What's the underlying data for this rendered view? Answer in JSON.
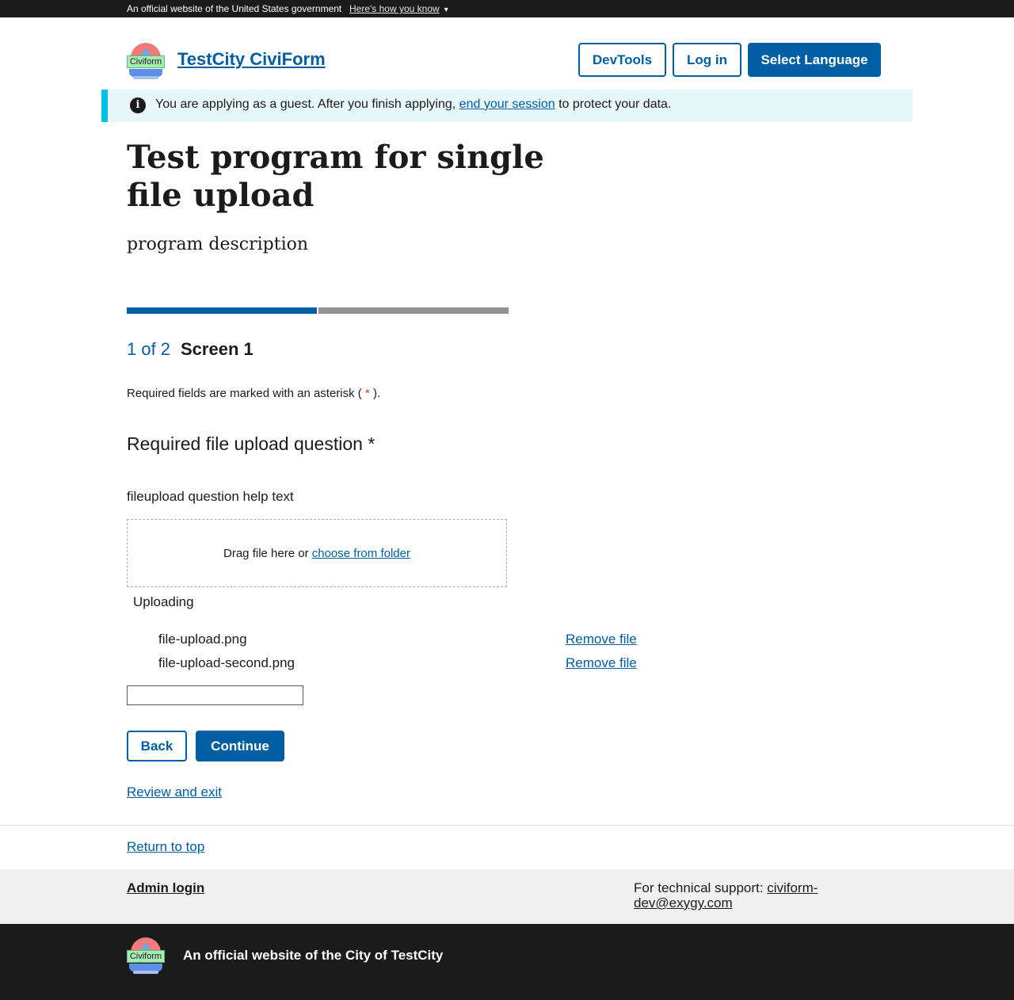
{
  "gov_banner": {
    "text": "An official website of the United States government",
    "link": "Here's how you know",
    "link_icon": "chevron-down-icon"
  },
  "header": {
    "logo_text": "Civiform",
    "site_title": "TestCity CiviForm",
    "devtools_label": "DevTools",
    "login_label": "Log in",
    "language_label": "Select Language"
  },
  "alert": {
    "icon": "info-icon",
    "text_before": "You are applying as a guest. After you finish applying, ",
    "link": "end your session",
    "text_after": " to protect your data."
  },
  "program": {
    "title": "Test program for single file upload",
    "description": "program description"
  },
  "progress": {
    "current_step": 1,
    "total_steps": 2,
    "step_label": "1 of 2",
    "screen_name": "Screen 1"
  },
  "form": {
    "required_note_before": "Required fields are marked with an asterisk (",
    "required_asterisk": "*",
    "required_note_after": ").",
    "question_title": "Required file upload question *",
    "question_help": "fileupload question help text",
    "dropzone_text": "Drag file here or ",
    "dropzone_link": "choose from folder",
    "uploading_label": "Uploading",
    "files": [
      {
        "name": "file-upload.png",
        "remove_label": "Remove file"
      },
      {
        "name": "file-upload-second.png",
        "remove_label": "Remove file"
      }
    ],
    "back_label": "Back",
    "continue_label": "Continue",
    "review_label": "Review and exit"
  },
  "footer": {
    "return_to_top": "Return to top",
    "admin_login": "Admin login",
    "support_text": "For technical support: ",
    "support_email": "civiform-dev@exygy.com",
    "logo_text": "Civiform",
    "official_text": "An official website of the City of TestCity"
  },
  "colors": {
    "primary": "#005ea2",
    "dark": "#1b1b1b",
    "alert_bg": "#e7f6f8",
    "alert_border": "#00bde3",
    "progress_inactive": "#919191",
    "footer_bg": "#f0f0f0"
  }
}
